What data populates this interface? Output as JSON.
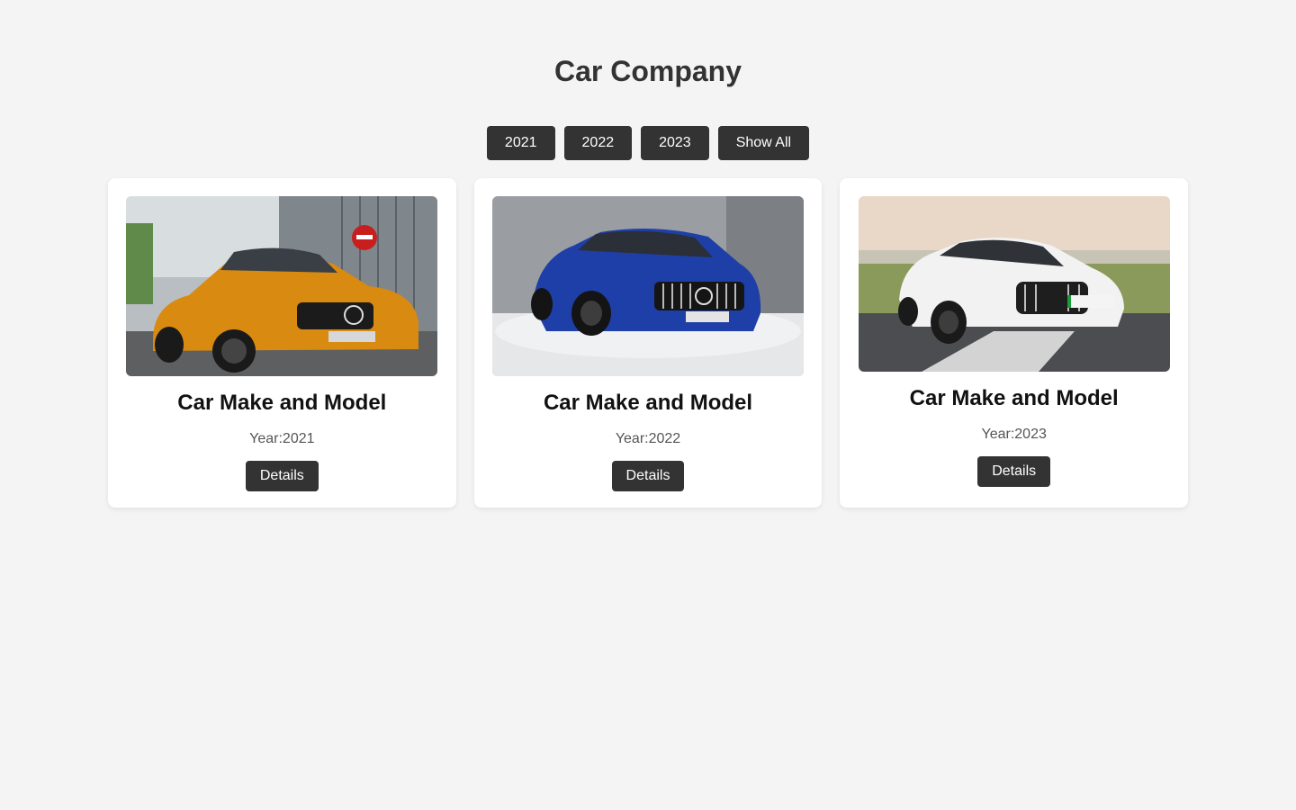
{
  "header": {
    "title": "Car Company"
  },
  "filters": [
    {
      "label": "2021"
    },
    {
      "label": "2022"
    },
    {
      "label": "2023"
    },
    {
      "label": "Show All"
    }
  ],
  "cars": [
    {
      "title": "Car Make and Model",
      "year_label": "Year:",
      "year": "2021",
      "button_label": "Details",
      "image": {
        "description_icon": "orange-sports-car-image",
        "car_color": "#d98a10",
        "background_color": "#9aa0a4"
      }
    },
    {
      "title": "Car Make and Model",
      "year_label": "Year:",
      "year": "2022",
      "button_label": "Details",
      "image": {
        "description_icon": "blue-sports-car-image",
        "car_color": "#1f3fa8",
        "background_color": "#8e9196"
      }
    },
    {
      "title": "Car Make and Model",
      "year_label": "Year:",
      "year": "2023",
      "button_label": "Details",
      "image": {
        "description_icon": "white-sedan-car-image",
        "car_color": "#f2f2f2",
        "background_color": "#c9b9a8"
      }
    }
  ],
  "colors": {
    "page_background": "#f4f4f4",
    "button_background": "#333333",
    "button_text": "#ffffff",
    "card_background": "#ffffff"
  }
}
